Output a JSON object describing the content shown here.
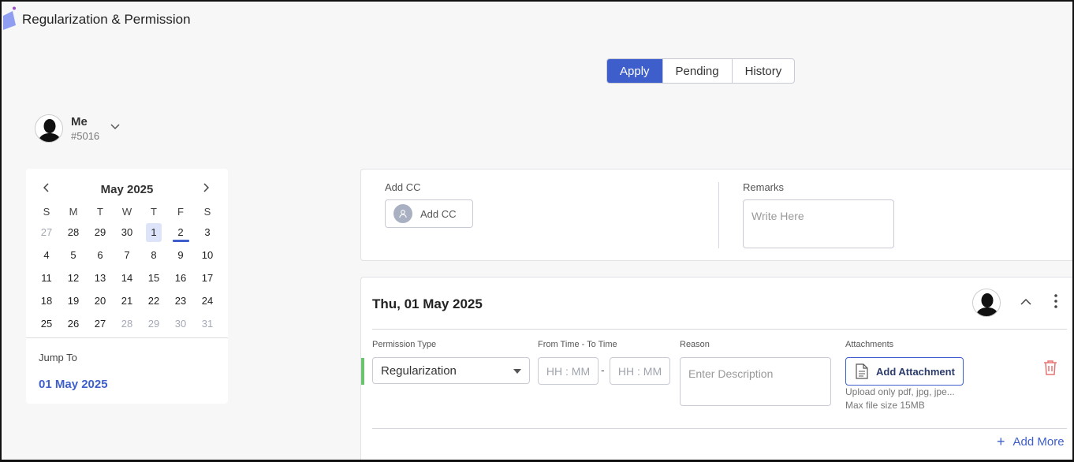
{
  "app": {
    "title": "Regularization & Permission"
  },
  "tabs": [
    {
      "label": "Apply",
      "active": true
    },
    {
      "label": "Pending",
      "active": false
    },
    {
      "label": "History",
      "active": false
    }
  ],
  "user": {
    "name": "Me",
    "id": "#5016"
  },
  "calendar": {
    "month_label": "May 2025",
    "weekdays": [
      "S",
      "M",
      "T",
      "W",
      "T",
      "F",
      "S"
    ],
    "weeks": [
      [
        "27",
        "28",
        "29",
        "30",
        "1",
        "2",
        "3"
      ],
      [
        "4",
        "5",
        "6",
        "7",
        "8",
        "9",
        "10"
      ],
      [
        "11",
        "12",
        "13",
        "14",
        "15",
        "16",
        "17"
      ],
      [
        "18",
        "19",
        "20",
        "21",
        "22",
        "23",
        "24"
      ],
      [
        "25",
        "26",
        "27",
        "28",
        "29",
        "30",
        "31"
      ]
    ],
    "jump_label": "Jump To",
    "jump_date": "01 May 2025"
  },
  "cc": {
    "label": "Add CC",
    "button_label": "Add CC"
  },
  "remarks": {
    "label": "Remarks",
    "placeholder": "Write Here"
  },
  "entry": {
    "date_title": "Thu, 01 May 2025",
    "permission_type_label": "Permission Type",
    "permission_type_value": "Regularization",
    "time_label": "From Time - To Time",
    "from_placeholder": "HH : MM",
    "to_placeholder": "HH : MM",
    "time_separator": "-",
    "reason_label": "Reason",
    "reason_placeholder": "Enter Description",
    "attachments_label": "Attachments",
    "attach_button": "Add Attachment",
    "attach_hint_types": "Upload only pdf, jpg, jpe...",
    "attach_hint_size": "Max file size 15MB",
    "add_more_label": "Add More"
  },
  "colors": {
    "accent": "#3e5fcb",
    "selected_bg": "#dde4fa",
    "delete": "#e57373",
    "status_bar": "#6cc36f"
  }
}
